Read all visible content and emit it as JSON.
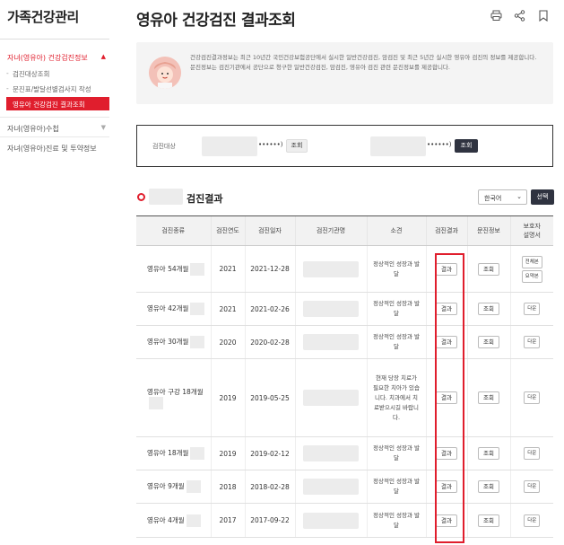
{
  "sidebar": {
    "title": "가족건강관리",
    "group1": "자녀(영유아) 건강검진정보",
    "sub1": "검진대상조회",
    "sub2": "문진표/발달선별검사지 작성",
    "active": "영유아 건강검진 결과조회",
    "group2": "자녀(영유아)수첩",
    "group3": "자녀(영유아)진료 및 투약정보"
  },
  "header": {
    "title": "영유아 건강검진 결과조회",
    "icons": [
      "print-icon",
      "share-icon",
      "bookmark-icon"
    ]
  },
  "info": {
    "text1": "건강검진결과정보는 최근 10년간 국민건강보험공단에서 실시한 일반건강검진, 암검진 및 최근 5년간 실시한 영유아 검진의 정보를 제공합니다.",
    "text2": "문진정보는 검진기관에서 공단으로 청구한 일반건강검진, 암검진, 영유아 검진 관련 문진정보를 제공합니다."
  },
  "search": {
    "label": "검진대상",
    "masked1": "••••••)",
    "btn1": "조회",
    "masked2": "••••••)",
    "btn2": "조회"
  },
  "results": {
    "title": "검진결과",
    "language": "한국어",
    "select_btn": "선택",
    "headers": [
      "검진종류",
      "검진연도",
      "검진일자",
      "검진기관명",
      "소견",
      "검진결과",
      "문진정보",
      "보호자 설명서"
    ],
    "rows": [
      {
        "type": "영유아 54개월",
        "year": "2021",
        "date": "2021-12-28",
        "cond": "정상적인 성장과 발달",
        "result": "결과",
        "inquiry": "조회",
        "guide": [
          "전체본",
          "요약본"
        ]
      },
      {
        "type": "영유아 42개월",
        "year": "2021",
        "date": "2021-02-26",
        "cond": "정상적인 성장과 발달",
        "result": "결과",
        "inquiry": "조회",
        "guide": [
          "다운"
        ]
      },
      {
        "type": "영유아 30개월",
        "year": "2020",
        "date": "2020-02-28",
        "cond": "정상적인 성장과 발달",
        "result": "결과",
        "inquiry": "조회",
        "guide": [
          "다운"
        ]
      },
      {
        "type": "영유아 구강 18개월",
        "year": "2019",
        "date": "2019-05-25",
        "cond": "현재 당장 치료가 필요한 치아가 있습니다. 치과에서 치료받으시길 바랍니다.",
        "result": "결과",
        "inquiry": "조회",
        "guide": [
          "다운"
        ]
      },
      {
        "type": "영유아 18개월",
        "year": "2019",
        "date": "2019-02-12",
        "cond": "정상적인 성장과 발달",
        "result": "결과",
        "inquiry": "조회",
        "guide": [
          "다운"
        ]
      },
      {
        "type": "영유아 9개월",
        "year": "2018",
        "date": "2018-02-28",
        "cond": "정상적인 성장과 발달",
        "result": "결과",
        "inquiry": "조회",
        "guide": [
          "다운"
        ]
      },
      {
        "type": "영유아 4개월",
        "year": "2017",
        "date": "2017-09-22",
        "cond": "정상적인 성장과 발달",
        "result": "결과",
        "inquiry": "조회",
        "guide": [
          "다운"
        ]
      }
    ]
  },
  "colors": {
    "accent": "#e01e2d",
    "dark_button": "#2f3340"
  }
}
